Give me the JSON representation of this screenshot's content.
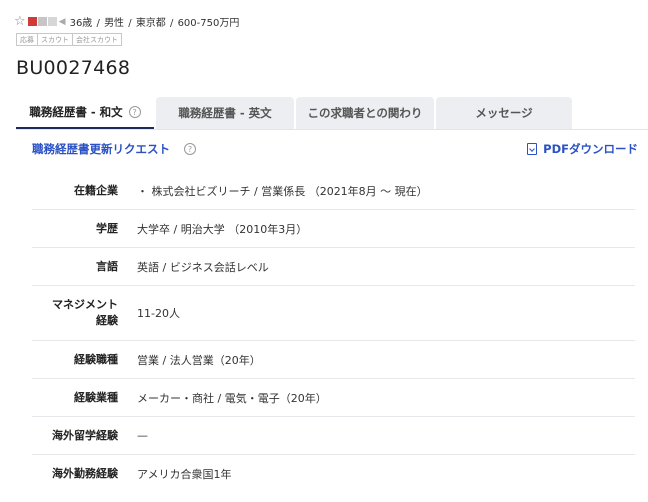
{
  "header": {
    "star_icon": "star-outline-icon",
    "status_icons": [
      "red-flag-icon",
      "grey-icon",
      "grey-icon",
      "speaker-icon"
    ],
    "profile": [
      "36歳",
      "男性",
      "東京都",
      "600-750万円"
    ],
    "profile_separator": " / ",
    "tags": [
      "応募",
      "スカウト",
      "会社スカウト"
    ],
    "user_id": "BU0027468"
  },
  "tabs": [
    {
      "label": "職務経歴書 - 和文",
      "active": true,
      "help": "?"
    },
    {
      "label": "職務経歴書 - 英文",
      "active": false
    },
    {
      "label": "この求職者との関わり",
      "active": false
    },
    {
      "label": "メッセージ",
      "active": false
    }
  ],
  "actions": {
    "request_label": "職務経歴書更新リクエスト",
    "request_help": "?",
    "pdf_label": "PDFダウンロード"
  },
  "profile_rows": [
    {
      "label": "在籍企業",
      "value": "・ 株式会社ビズリーチ / 営業係長 （2021年8月 〜 現在）"
    },
    {
      "label": "学歴",
      "value": "大学卒 /  明治大学  （2010年3月）"
    },
    {
      "label": "言語",
      "value": "英語 / ビジネス会話レベル"
    },
    {
      "label": "マネジメント経験",
      "label_lines": [
        "マネジメント",
        "経験"
      ],
      "value": "11-20人"
    },
    {
      "label": "経験職種",
      "value": "営業 / 法人営業（20年）"
    },
    {
      "label": "経験業種",
      "value": "メーカー・商社 / 電気・電子（20年）"
    },
    {
      "label": "海外留学経験",
      "value": "—"
    },
    {
      "label": "海外勤務経験",
      "value": "アメリカ合衆国1年"
    }
  ],
  "colors": {
    "link": "#2a51c5",
    "tab_active_underline": "#1a2b5c",
    "tab_bg": "#eceef2",
    "flag_red": "#d23a3a"
  }
}
